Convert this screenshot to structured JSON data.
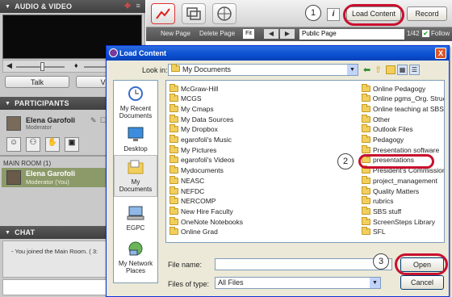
{
  "left_panel": {
    "audio_video": {
      "title": "AUDIO & VIDEO",
      "talk_label": "Talk",
      "video_label": "Video"
    },
    "participants": {
      "title": "PARTICIPANTS",
      "user_name": "Elena Garofoli",
      "user_role": "Moderator",
      "room_label": "MAIN ROOM",
      "room_count": "(1)",
      "room_member_name": "Elena Garofoli",
      "room_member_role": "Moderator (You)"
    },
    "chat": {
      "title": "CHAT",
      "message": "- You joined the Main Room. ( 3:"
    }
  },
  "toolbar": {
    "info_label": "i",
    "load_content_label": "Load Content",
    "record_label": "Record",
    "new_page_label": "New Page",
    "delete_page_label": "Delete Page",
    "fit_label": "Fit",
    "page_type": "Public Page",
    "page_counter": "1/42",
    "follow_label": "Follow"
  },
  "dialog": {
    "title": "Load Content",
    "look_in_label": "Look in:",
    "look_in_value": "My Documents",
    "places": [
      "My Recent Documents",
      "Desktop",
      "My Documents",
      "EGPC",
      "My Network Places"
    ],
    "files_left": [
      "McGraw-Hill",
      "MCGS",
      "My Cmaps",
      "My Data Sources",
      "My Dropbox",
      "egarofoli's Music",
      "My Pictures",
      "egarofoli's Videos",
      "Mydocuments",
      "NEASC",
      "NEFDC",
      "NERCOMP",
      "New Hire Faculty",
      "OneNote Notebooks",
      "Online Grad"
    ],
    "files_right": [
      "Online Pedagogy",
      "Online pgms_Org. Struc",
      "Online teaching at SBS",
      "Other",
      "Outlook Files",
      "Pedagogy",
      "Presentation software",
      "presentations",
      "President's Commission",
      "project_management",
      "Quality Matters",
      "rubrics",
      "SBS stuff",
      "ScreenSteps Library",
      "SFL"
    ],
    "file_name_label": "File name:",
    "file_name_value": "",
    "files_of_type_label": "Files of type:",
    "files_of_type_value": "All Files",
    "open_label": "Open",
    "cancel_label": "Cancel",
    "close_label": "X"
  },
  "callouts": [
    "1",
    "2",
    "3"
  ],
  "colors": {
    "callout_ring": "#c8102e",
    "dialog_title": "#0a4fd0",
    "selected_participant": "#8c9a6a"
  }
}
